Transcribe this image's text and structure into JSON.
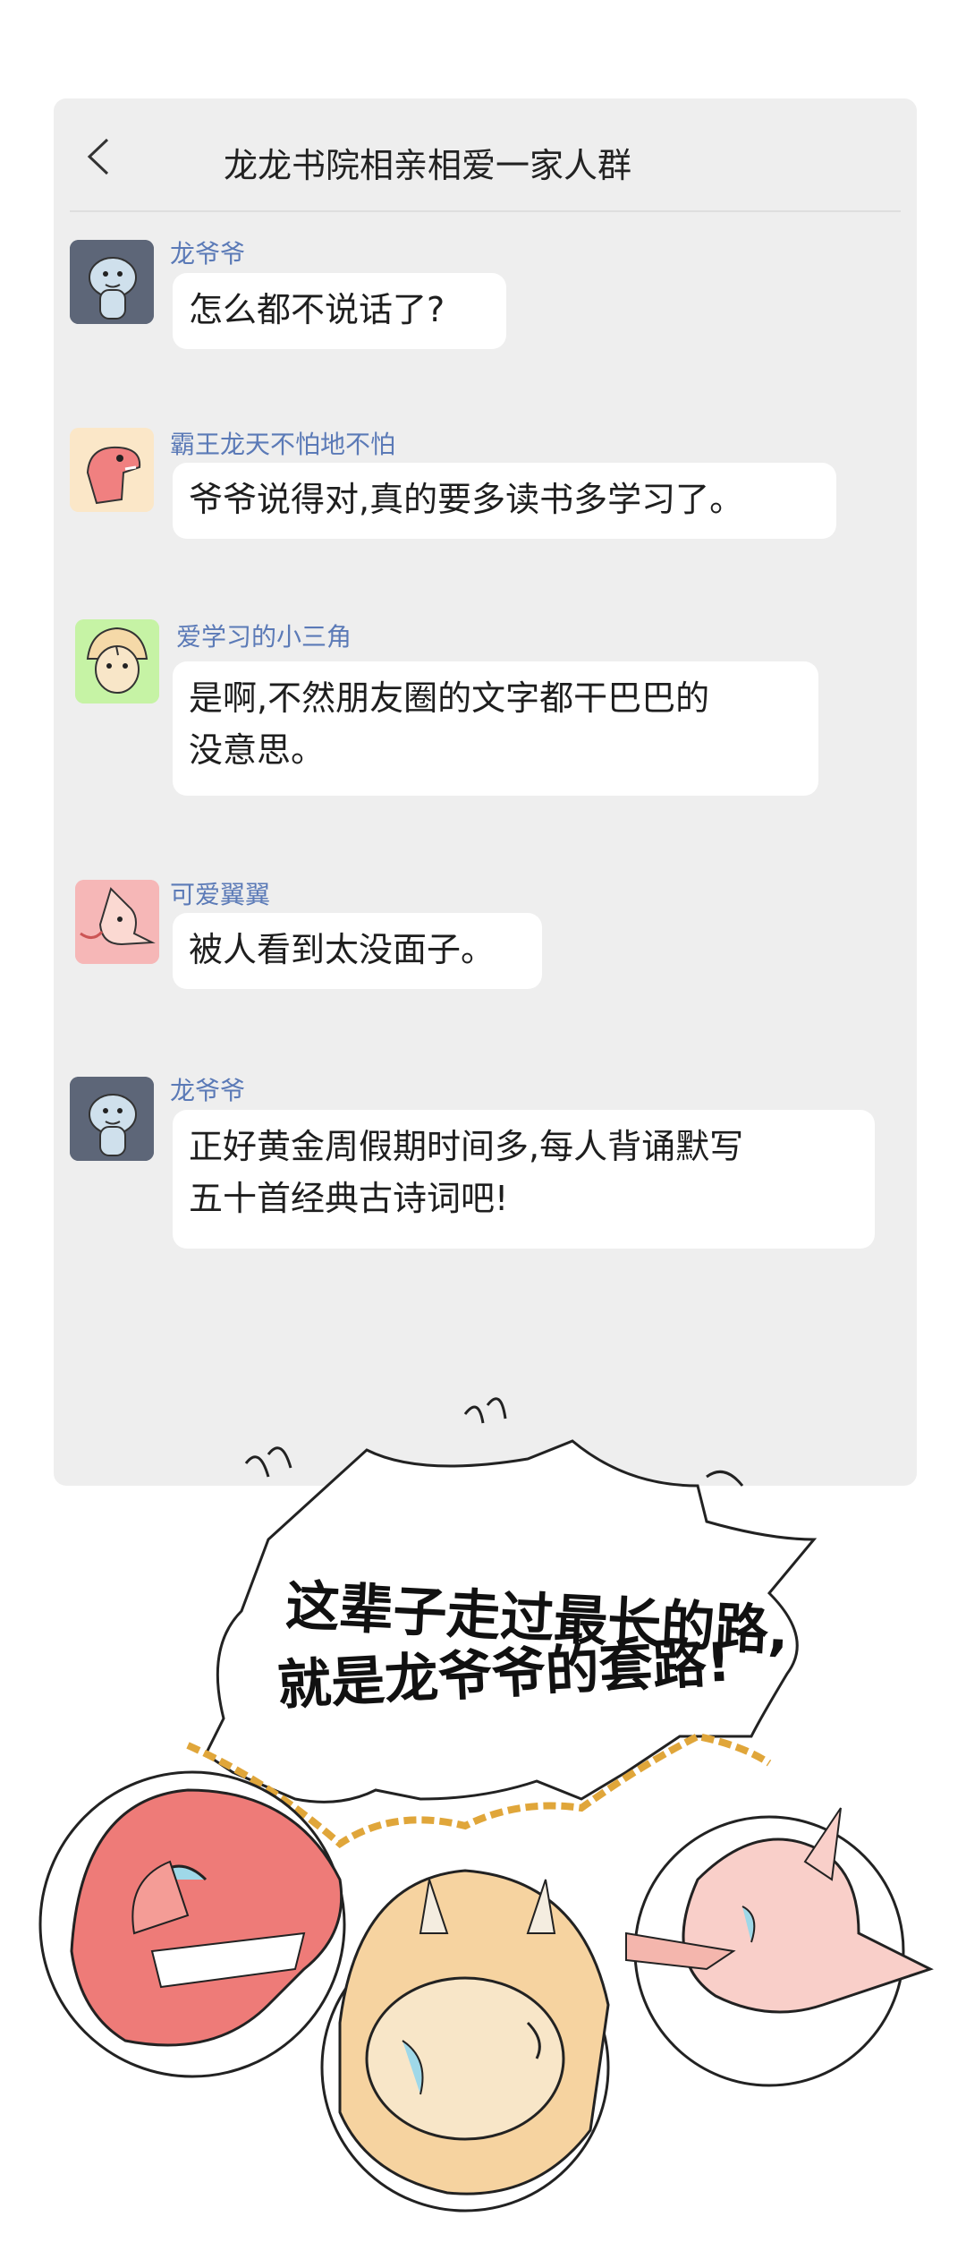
{
  "chat": {
    "back_icon": "chevron-left-icon",
    "title": "龙龙书院相亲相爱一家人群",
    "messages": [
      {
        "sender": "龙爷爷",
        "avatar": "blue-dinosaur-avatar",
        "text": "怎么都不说话了?"
      },
      {
        "sender": "霸王龙天不怕地不怕",
        "avatar": "red-t-rex-avatar",
        "text": "爷爷说得对,真的要多读书多学习了。"
      },
      {
        "sender": "爱学习的小三角",
        "avatar": "triceratops-avatar",
        "text": "是啊,不然朋友圈的文字都干巴巴的\n没意思。"
      },
      {
        "sender": "可爱翼翼",
        "avatar": "pterosaur-avatar",
        "text": "被人看到太没面子。"
      },
      {
        "sender": "龙爷爷",
        "avatar": "blue-dinosaur-avatar",
        "text": "正好黄金周假期时间多,每人背诵默写\n五十首经典古诗词吧!"
      }
    ]
  },
  "comic": {
    "speech_line_1": "这辈子走过最长的路,",
    "speech_line_2": "就是龙爷爷的套路!"
  },
  "colors": {
    "panel": "#eeeeee",
    "bubble": "#ffffff",
    "sender_name": "#5b7ab7"
  }
}
